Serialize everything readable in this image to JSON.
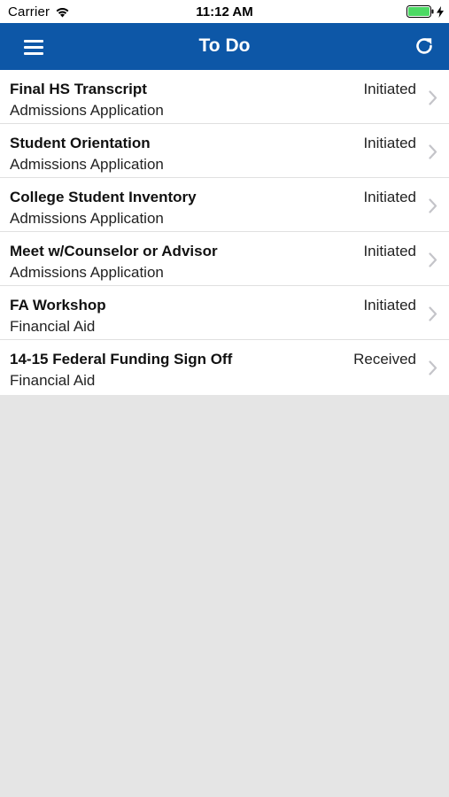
{
  "status_bar": {
    "carrier": "Carrier",
    "time": "11:12 AM",
    "battery_color": "#4cd964"
  },
  "nav": {
    "title": "To Do",
    "background": "#0d57a7",
    "menu_icon": "hamburger-menu-icon",
    "refresh_icon": "refresh-icon"
  },
  "items": [
    {
      "title": "Final HS Transcript",
      "subtitle": "Admissions Application",
      "status": "Initiated"
    },
    {
      "title": "Student Orientation",
      "subtitle": "Admissions Application",
      "status": "Initiated"
    },
    {
      "title": "College Student Inventory",
      "subtitle": "Admissions Application",
      "status": "Initiated"
    },
    {
      "title": "Meet w/Counselor or Advisor",
      "subtitle": "Admissions Application",
      "status": "Initiated"
    },
    {
      "title": "FA Workshop",
      "subtitle": "Financial Aid",
      "status": "Initiated"
    },
    {
      "title": "14-15 Federal Funding Sign Off",
      "subtitle": "Financial Aid",
      "status": "Received"
    }
  ]
}
